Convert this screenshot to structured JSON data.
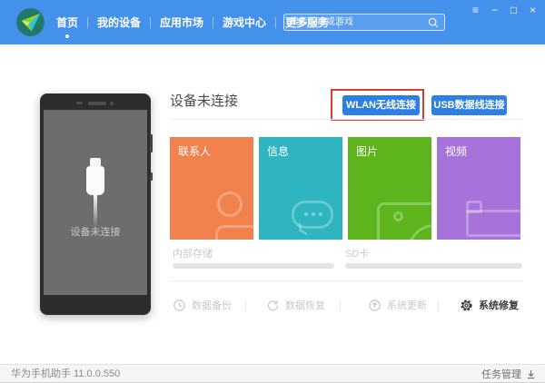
{
  "header": {
    "nav": [
      {
        "label": "首页",
        "active": true
      },
      {
        "label": "我的设备",
        "active": false
      },
      {
        "label": "应用市场",
        "active": false
      },
      {
        "label": "游戏中心",
        "active": false
      },
      {
        "label": "更多服务",
        "active": false
      }
    ],
    "search": {
      "placeholder": "搜索应用或游戏"
    },
    "controls": {
      "menu": "≡",
      "minimize": "−",
      "maximize": "□",
      "close": "×"
    }
  },
  "device_panel": {
    "title": "设备未连接",
    "wlan_button": "WLAN无线连接",
    "usb_button": "USB数据线连接"
  },
  "phone": {
    "status_label": "设备未连接"
  },
  "tiles": [
    {
      "label": "联系人",
      "color": "#f2824d",
      "icon": "contacts-icon"
    },
    {
      "label": "信息",
      "color": "#2eb5c0",
      "icon": "message-icon"
    },
    {
      "label": "图片",
      "color": "#5db41d",
      "icon": "picture-icon"
    },
    {
      "label": "视频",
      "color": "#a573da",
      "icon": "video-camera-icon"
    }
  ],
  "storage": [
    {
      "label": "内部存储"
    },
    {
      "label": "SD卡"
    }
  ],
  "actions": [
    {
      "label": "数据备份",
      "enabled": false,
      "icon": "backup-clock-icon"
    },
    {
      "label": "数据恢复",
      "enabled": false,
      "icon": "restore-arrow-icon"
    },
    {
      "label": "系统更新",
      "enabled": false,
      "icon": "update-arrow-icon"
    },
    {
      "label": "系统修复",
      "enabled": true,
      "icon": "repair-gear-icon"
    }
  ],
  "statusbar": {
    "app_version": "华为手机助手 11.0.0.550",
    "task_manager": "任务管理"
  },
  "colors": {
    "header_blue": "#4491ec",
    "button_blue": "#2e7fe4",
    "annotation_red": "#dc3a35",
    "tile_orange": "#f2824d",
    "tile_teal": "#2eb5c0",
    "tile_green": "#5db41d",
    "tile_purple": "#a573da"
  }
}
